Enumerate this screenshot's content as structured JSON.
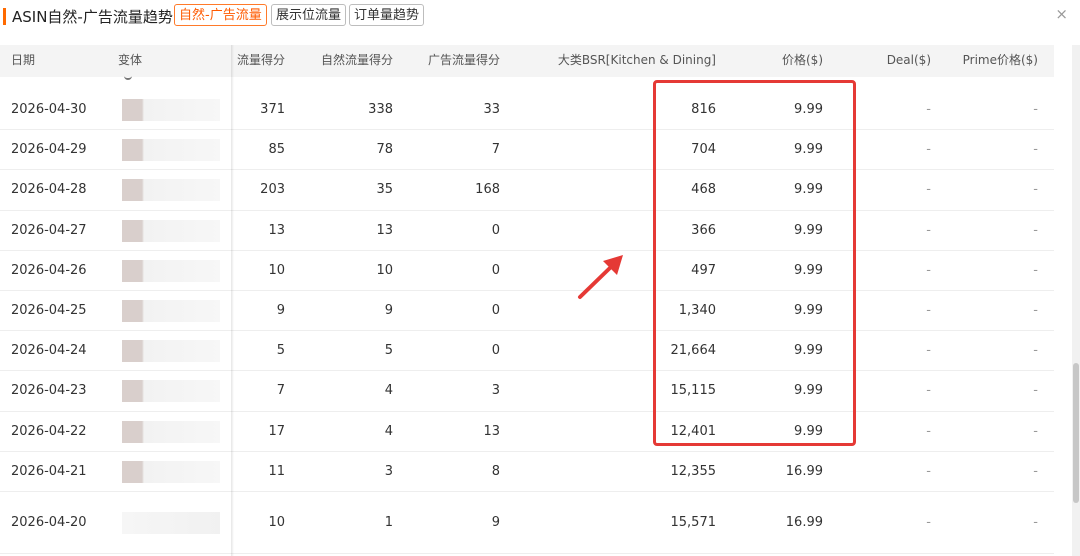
{
  "header": {
    "title": "ASIN自然-广告流量趋势",
    "tabs": [
      {
        "label": "自然-广告流量",
        "active": true
      },
      {
        "label": "展示位流量",
        "active": false
      },
      {
        "label": "订单量趋势",
        "active": false
      }
    ],
    "close_icon": "×"
  },
  "table": {
    "columns": [
      "日期",
      "变体",
      "流量得分",
      "自然流量得分",
      "广告流量得分",
      "大类BSR[Kitchen & Dining]",
      "价格($)",
      "Deal($)",
      "Prime价格($)"
    ],
    "rows": [
      {
        "date": "2026-04-30",
        "traffic": "371",
        "organic": "338",
        "ad": "33",
        "bsr": "816",
        "price": "9.99",
        "deal": "-",
        "prime": "-"
      },
      {
        "date": "2026-04-29",
        "traffic": "85",
        "organic": "78",
        "ad": "7",
        "bsr": "704",
        "price": "9.99",
        "deal": "-",
        "prime": "-"
      },
      {
        "date": "2026-04-28",
        "traffic": "203",
        "organic": "35",
        "ad": "168",
        "bsr": "468",
        "price": "9.99",
        "deal": "-",
        "prime": "-"
      },
      {
        "date": "2026-04-27",
        "traffic": "13",
        "organic": "13",
        "ad": "0",
        "bsr": "366",
        "price": "9.99",
        "deal": "-",
        "prime": "-"
      },
      {
        "date": "2026-04-26",
        "traffic": "10",
        "organic": "10",
        "ad": "0",
        "bsr": "497",
        "price": "9.99",
        "deal": "-",
        "prime": "-"
      },
      {
        "date": "2026-04-25",
        "traffic": "9",
        "organic": "9",
        "ad": "0",
        "bsr": "1,340",
        "price": "9.99",
        "deal": "-",
        "prime": "-"
      },
      {
        "date": "2026-04-24",
        "traffic": "5",
        "organic": "5",
        "ad": "0",
        "bsr": "21,664",
        "price": "9.99",
        "deal": "-",
        "prime": "-"
      },
      {
        "date": "2026-04-23",
        "traffic": "7",
        "organic": "4",
        "ad": "3",
        "bsr": "15,115",
        "price": "9.99",
        "deal": "-",
        "prime": "-"
      },
      {
        "date": "2026-04-22",
        "traffic": "17",
        "organic": "4",
        "ad": "13",
        "bsr": "12,401",
        "price": "9.99",
        "deal": "-",
        "prime": "-"
      },
      {
        "date": "2026-04-21",
        "traffic": "11",
        "organic": "3",
        "ad": "8",
        "bsr": "12,355",
        "price": "16.99",
        "deal": "-",
        "prime": "-"
      },
      {
        "date": "2026-04-20",
        "traffic": "10",
        "organic": "1",
        "ad": "9",
        "bsr": "15,571",
        "price": "16.99",
        "deal": "-",
        "prime": "-"
      }
    ]
  },
  "colors": {
    "accent": "#ff6a00",
    "highlight": "#e53935"
  },
  "icons": {
    "close": "close-icon",
    "annotation": "red-arrow-icon"
  }
}
